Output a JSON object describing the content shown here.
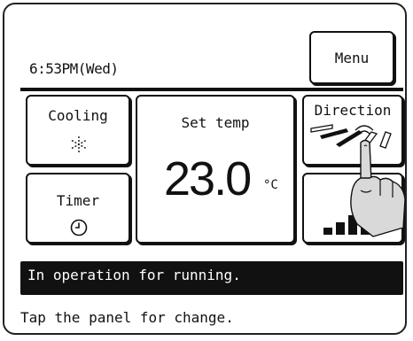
{
  "header": {
    "clock": "6:53PM(Wed)",
    "menu_label": "Menu"
  },
  "mode": {
    "label": "Cooling",
    "icon": "snowflake-icon"
  },
  "timer": {
    "label": "Timer",
    "icon": "clock-icon"
  },
  "set_temp": {
    "label": "Set temp",
    "value": "23.0",
    "unit": "°C"
  },
  "direction": {
    "label": "Direction",
    "icon": "airflow-direction-icon"
  },
  "fan_speed": {
    "label": "",
    "icon": "fan-speed-bars-icon",
    "level_fraction": 0.75
  },
  "status": {
    "message": "In operation for running."
  },
  "hint": {
    "text": "Tap the panel for change."
  }
}
